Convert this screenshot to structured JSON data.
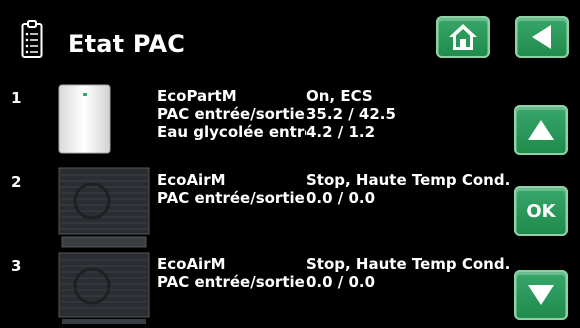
{
  "header": {
    "title": "Etat PAC"
  },
  "units": [
    {
      "index": "1",
      "name": "EcoPartM",
      "status": "On, ECS",
      "rows": [
        {
          "label": "PAC entrée/sortie",
          "value": "35.2 / 42.5"
        },
        {
          "label": "Eau glycolée entrée/sortie",
          "value": "4.2 / 1.2"
        }
      ]
    },
    {
      "index": "2",
      "name": "EcoAirM",
      "status": "Stop, Haute Temp Cond.",
      "rows": [
        {
          "label": "PAC entrée/sortie",
          "value": "0.0 / 0.0"
        }
      ]
    },
    {
      "index": "3",
      "name": "EcoAirM",
      "status": "Stop, Haute Temp Cond.",
      "rows": [
        {
          "label": "PAC entrée/sortie",
          "value": "0.0 / 0.0"
        }
      ]
    }
  ],
  "buttons": {
    "ok_label": "OK"
  },
  "icons": {
    "title": "clipboard-icon",
    "home": "home-icon",
    "back": "back-arrow-icon",
    "up": "up-arrow-icon",
    "down": "down-arrow-icon"
  },
  "colors": {
    "background": "#000000",
    "button_green": "#2a9a5a",
    "text": "#ffffff"
  }
}
